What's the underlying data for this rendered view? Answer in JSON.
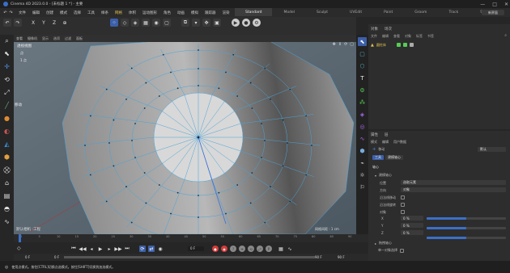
{
  "titlebar": {
    "title": "Cinema 4D 2023.0.0 - [未标题 1 *] - 主要",
    "min": "—",
    "max": "□",
    "close": "✕"
  },
  "menubar": {
    "items": [
      "文件",
      "编辑",
      "创建",
      "模式",
      "选择",
      "工具",
      "样条",
      "网格",
      "体积",
      "运动图形",
      "角色",
      "动画",
      "模拟",
      "跟踪器",
      "渲染",
      "扩展",
      "窗口",
      "帮助"
    ],
    "selected_index": 7,
    "layouts": [
      "Standard",
      "Model",
      "Sculpt",
      "UVEdit",
      "Paint",
      "Groom",
      "Track",
      "Script",
      "Nodes"
    ],
    "active_layout": 0,
    "new_layout": "新界面"
  },
  "toolbar": {
    "coord": [
      "X",
      "Y",
      "Z"
    ],
    "tooltip_title": "点",
    "tooltip_text": "使用点模式。按住[CTRL]切换点选模式。按住[SHIFT]切换到加选模式。"
  },
  "viewport": {
    "menu": [
      "查看",
      "摄像机",
      "显示",
      "选项",
      "过滤",
      "面板"
    ],
    "label_top": "透视视图",
    "label_tool": "点",
    "label_sub": "1 点",
    "move_label": "移动",
    "view_name": "默认相机 :工程",
    "grid_spacing": "网格间距 : 1 cm"
  },
  "object_panel": {
    "tabs": [
      "对象",
      "场次"
    ],
    "menu": [
      "文件",
      "编辑",
      "查看",
      "对象",
      "标签",
      "书签"
    ],
    "object_name": "圆柱体"
  },
  "attr_panel": {
    "tabs": [
      "属性",
      "层"
    ],
    "menu": [
      "模式",
      "编辑",
      "用户数据"
    ],
    "tool_name": "移动",
    "mode_select": "默认",
    "subtabs": [
      "工具",
      "建模轴心"
    ],
    "section": "轴心",
    "group": "建模轴心",
    "rows": [
      {
        "label": "位置",
        "value": "选取元素"
      },
      {
        "label": "方向",
        "value": "对象"
      },
      {
        "label": "沿法线移动",
        "value": ""
      },
      {
        "label": "沿法线旋转",
        "value": ""
      },
      {
        "label": "对象",
        "value": ""
      }
    ],
    "axes": [
      {
        "label": "X",
        "value": "0 %",
        "fill": 0.5
      },
      {
        "label": "Y",
        "value": "0 %",
        "fill": 0.5
      },
      {
        "label": "Z",
        "value": "0 %",
        "fill": 0.5
      }
    ],
    "section2": "拖拽轴心",
    "section2_row": "单一对象选择"
  },
  "timeline": {
    "ticks": [
      "0",
      "5",
      "10",
      "15",
      "20",
      "25",
      "30",
      "35",
      "40",
      "45",
      "50",
      "55",
      "60",
      "65",
      "70",
      "75",
      "80",
      "85",
      "90"
    ],
    "current_frame": "0 F",
    "range_start": "0 F",
    "range_start2": "0 F",
    "range_end": "90 F",
    "range_end2": "90 F"
  },
  "status": {
    "text": "使用点模式。按住[CTRL]切换点选模式。按住[SHIFT]切换到加选模式。"
  },
  "colors": {
    "accent": "#3c5fa8",
    "highlight": "#e0c050",
    "mesh_edge": "#4aa3d8"
  }
}
